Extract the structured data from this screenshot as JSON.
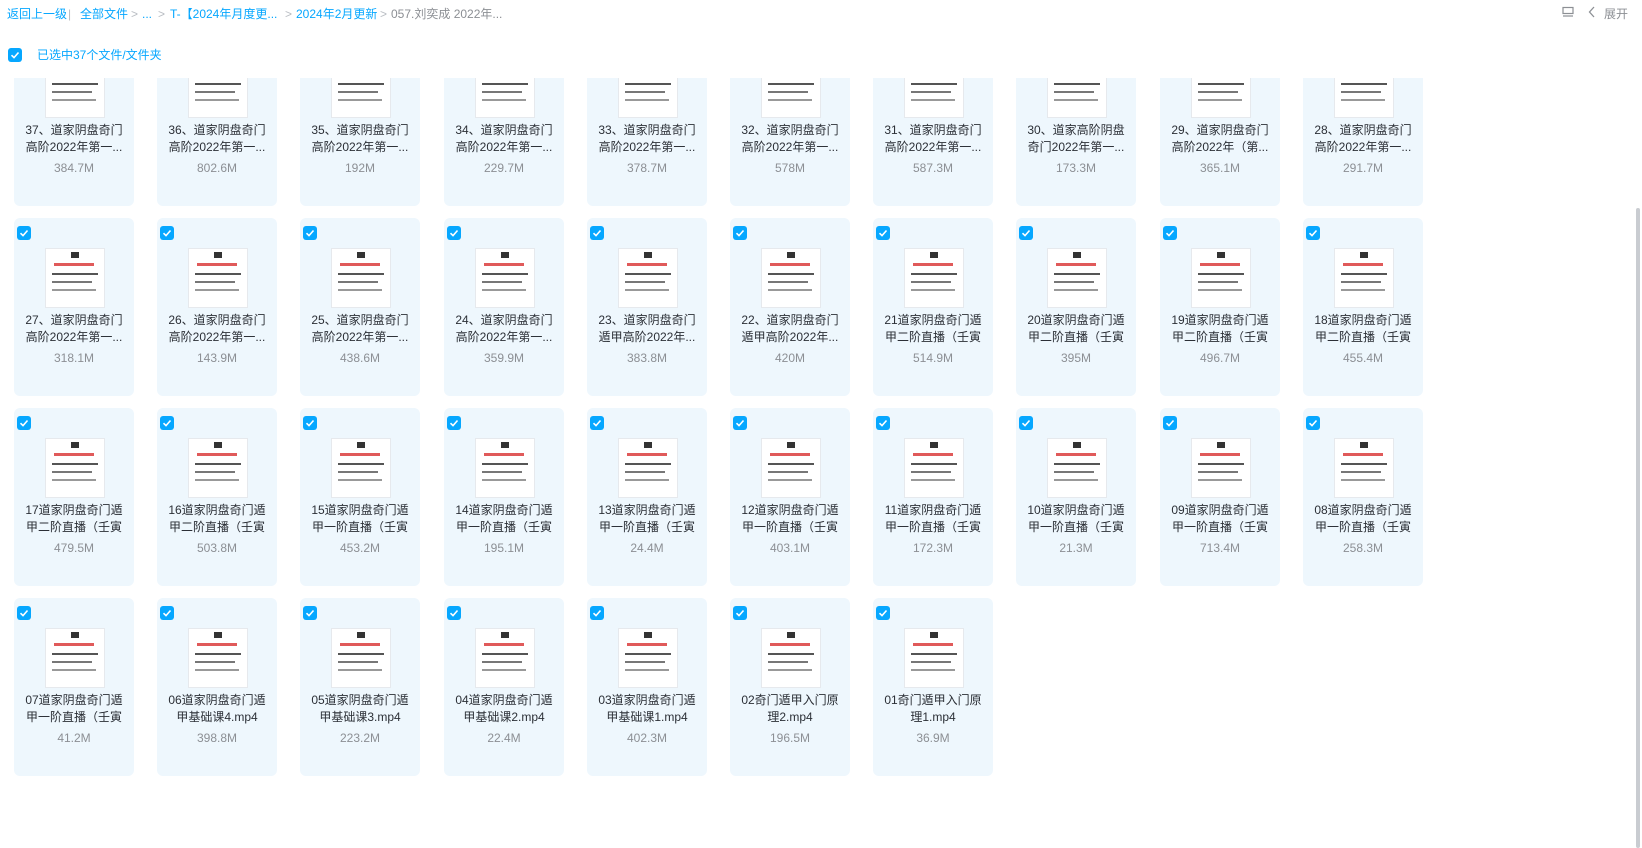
{
  "breadcrumb": {
    "back": "返回上一级",
    "all_files": "全部文件",
    "ellipsis": "...",
    "folder1": "T-【2024年月度更...",
    "folder2": "2024年2月更新",
    "current": "057.刘奕成 2022年..."
  },
  "toolbar": {
    "expand_label": "展开"
  },
  "selection": {
    "text": "已选中37个文件/文件夹"
  },
  "files": [
    {
      "name": "37、道家阴盘奇门高阶2022年第一...",
      "size": "384.7M",
      "checked": false
    },
    {
      "name": "36、道家阴盘奇门高阶2022年第一...",
      "size": "802.6M",
      "checked": false
    },
    {
      "name": "35、道家阴盘奇门高阶2022年第一...",
      "size": "192M",
      "checked": false
    },
    {
      "name": "34、道家阴盘奇门高阶2022年第一...",
      "size": "229.7M",
      "checked": false
    },
    {
      "name": "33、道家阴盘奇门高阶2022年第一...",
      "size": "378.7M",
      "checked": false
    },
    {
      "name": "32、道家阴盘奇门高阶2022年第一...",
      "size": "578M",
      "checked": false
    },
    {
      "name": "31、道家阴盘奇门高阶2022年第一...",
      "size": "587.3M",
      "checked": false
    },
    {
      "name": "30、道家高阶阴盘奇门2022年第一...",
      "size": "173.3M",
      "checked": false
    },
    {
      "name": "29、道家阴盘奇门高阶2022年（第...",
      "size": "365.1M",
      "checked": false
    },
    {
      "name": "28、道家阴盘奇门高阶2022年第一...",
      "size": "291.7M",
      "checked": false
    },
    {
      "name": "27、道家阴盘奇门高阶2022年第一...",
      "size": "318.1M",
      "checked": true
    },
    {
      "name": "26、道家阴盘奇门高阶2022年第一...",
      "size": "143.9M",
      "checked": true
    },
    {
      "name": "25、道家阴盘奇门高阶2022年第一...",
      "size": "438.6M",
      "checked": true
    },
    {
      "name": "24、道家阴盘奇门高阶2022年第一...",
      "size": "359.9M",
      "checked": true
    },
    {
      "name": "23、道家阴盘奇门遁甲高阶2022年...",
      "size": "383.8M",
      "checked": true
    },
    {
      "name": "22、道家阴盘奇门遁甲高阶2022年...",
      "size": "420M",
      "checked": true
    },
    {
      "name": "21道家阴盘奇门遁甲二阶直播（壬寅",
      "size": "514.9M",
      "checked": true
    },
    {
      "name": "20道家阴盘奇门遁甲二阶直播（壬寅",
      "size": "395M",
      "checked": true
    },
    {
      "name": "19道家阴盘奇门遁甲二阶直播（壬寅",
      "size": "496.7M",
      "checked": true
    },
    {
      "name": "18道家阴盘奇门遁甲二阶直播（壬寅",
      "size": "455.4M",
      "checked": true
    },
    {
      "name": "17道家阴盘奇门遁甲二阶直播（壬寅",
      "size": "479.5M",
      "checked": true
    },
    {
      "name": "16道家阴盘奇门遁甲二阶直播（壬寅",
      "size": "503.8M",
      "checked": true
    },
    {
      "name": "15道家阴盘奇门遁甲一阶直播（壬寅",
      "size": "453.2M",
      "checked": true
    },
    {
      "name": "14道家阴盘奇门遁甲一阶直播（壬寅",
      "size": "195.1M",
      "checked": true
    },
    {
      "name": "13道家阴盘奇门遁甲一阶直播（壬寅",
      "size": "24.4M",
      "checked": true
    },
    {
      "name": "12道家阴盘奇门遁甲一阶直播（壬寅",
      "size": "403.1M",
      "checked": true
    },
    {
      "name": "11道家阴盘奇门遁甲一阶直播（壬寅",
      "size": "172.3M",
      "checked": true
    },
    {
      "name": "10道家阴盘奇门遁甲一阶直播（壬寅",
      "size": "21.3M",
      "checked": true
    },
    {
      "name": "09道家阴盘奇门遁甲一阶直播（壬寅",
      "size": "713.4M",
      "checked": true
    },
    {
      "name": "08道家阴盘奇门遁甲一阶直播（壬寅",
      "size": "258.3M",
      "checked": true
    },
    {
      "name": "07道家阴盘奇门遁甲一阶直播（壬寅",
      "size": "41.2M",
      "checked": true
    },
    {
      "name": "06道家阴盘奇门遁甲基础课4.mp4",
      "size": "398.8M",
      "checked": true
    },
    {
      "name": "05道家阴盘奇门遁甲基础课3.mp4",
      "size": "223.2M",
      "checked": true
    },
    {
      "name": "04道家阴盘奇门遁甲基础课2.mp4",
      "size": "22.4M",
      "checked": true
    },
    {
      "name": "03道家阴盘奇门遁甲基础课1.mp4",
      "size": "402.3M",
      "checked": true
    },
    {
      "name": "02奇门遁甲入门原理2.mp4",
      "size": "196.5M",
      "checked": true
    },
    {
      "name": "01奇门遁甲入门原理1.mp4",
      "size": "36.9M",
      "checked": true
    }
  ],
  "colors": {
    "accent": "#06a7ff",
    "tile_bg": "#eef7fd",
    "text": "#2b2f36",
    "muted": "#8c8f94"
  }
}
